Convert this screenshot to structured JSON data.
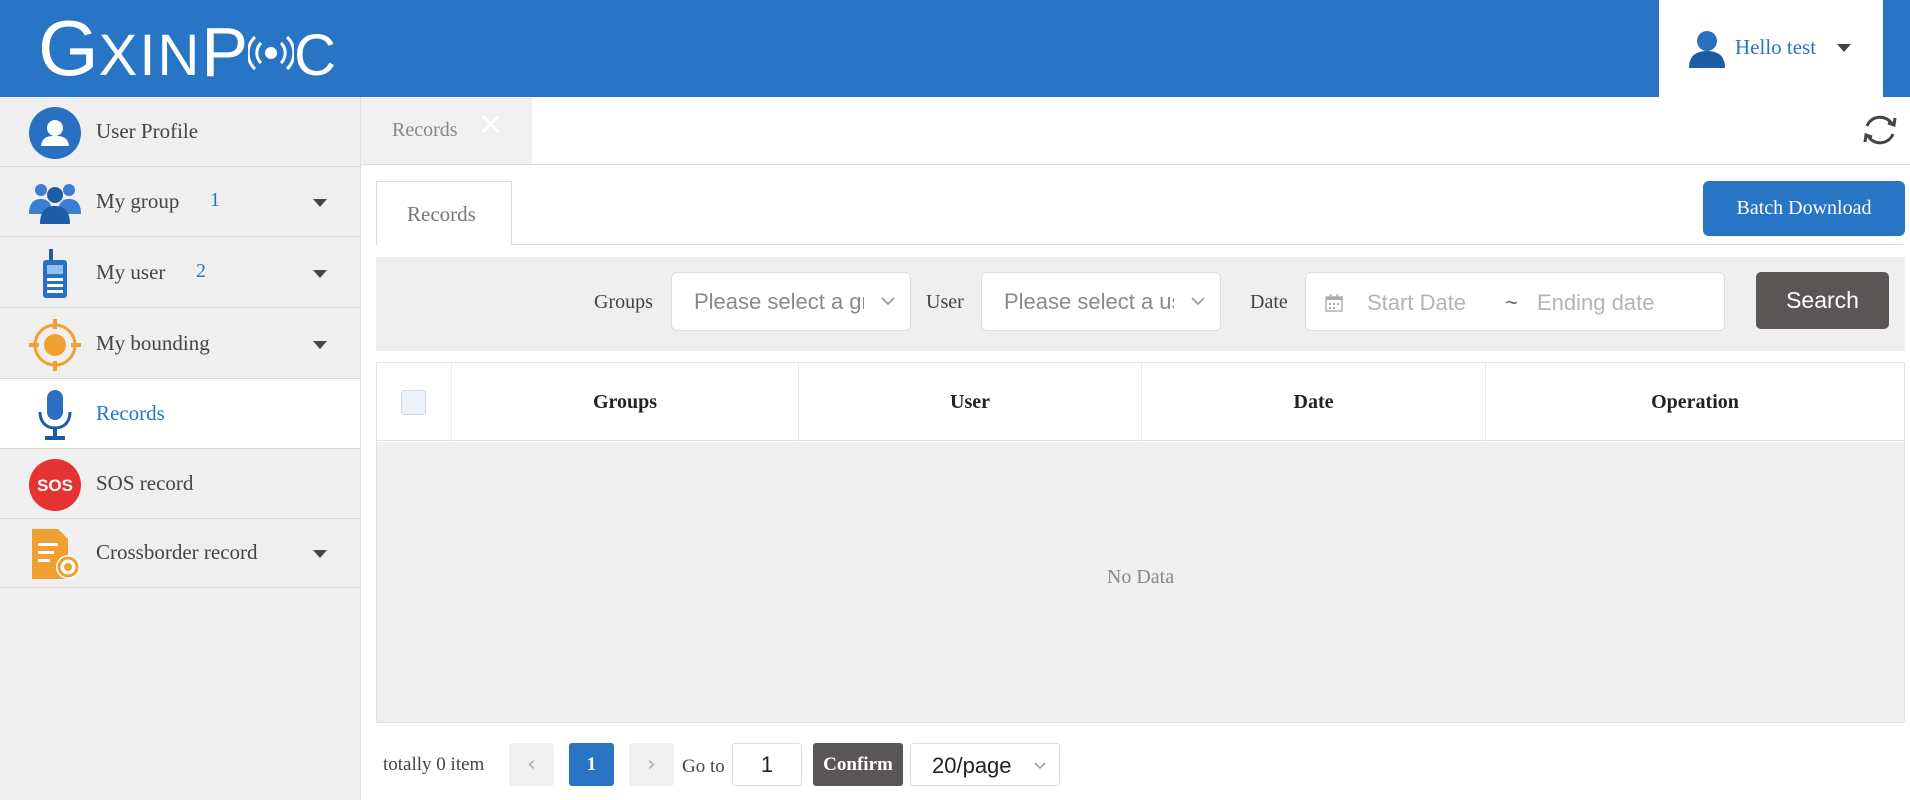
{
  "header": {
    "logo": {
      "big": "G",
      "mid": "XIN",
      "p": "P",
      "tail": "C"
    },
    "greeting": "Hello test",
    "brand_color": "#2775c4"
  },
  "sidebar": {
    "items": [
      {
        "label": "User Profile",
        "icon": "user-profile-icon"
      },
      {
        "label": "My group",
        "count": "1",
        "icon": "group-icon",
        "expandable": true
      },
      {
        "label": "My user",
        "count": "2",
        "icon": "walkie-talkie-icon",
        "expandable": true
      },
      {
        "label": "My bounding",
        "icon": "target-icon",
        "expandable": true
      },
      {
        "label": "Records",
        "icon": "microphone-icon",
        "active": true
      },
      {
        "label": "SOS record",
        "icon": "sos-icon",
        "icon_text": "SOS"
      },
      {
        "label": "Crossborder record",
        "icon": "document-icon",
        "expandable": true
      }
    ]
  },
  "tabs": {
    "open_tab": "Records",
    "close_glyph": "✕"
  },
  "content": {
    "tab": "Records",
    "batch_download": "Batch Download"
  },
  "filters": {
    "groups_label": "Groups",
    "groups_placeholder": "Please select a group",
    "user_label": "User",
    "user_placeholder": "Please select a user",
    "date_label": "Date",
    "start_placeholder": "Start Date",
    "separator": "~",
    "end_placeholder": "Ending date",
    "search": "Search"
  },
  "table": {
    "columns": [
      "Groups",
      "User",
      "Date",
      "Operation"
    ],
    "empty_text": "No Data"
  },
  "pagination": {
    "total": "totally 0 item",
    "prev": "‹",
    "current": "1",
    "next": "›",
    "goto_label": "Go to",
    "goto_value": "1",
    "confirm": "Confirm",
    "page_size": "20/page"
  }
}
